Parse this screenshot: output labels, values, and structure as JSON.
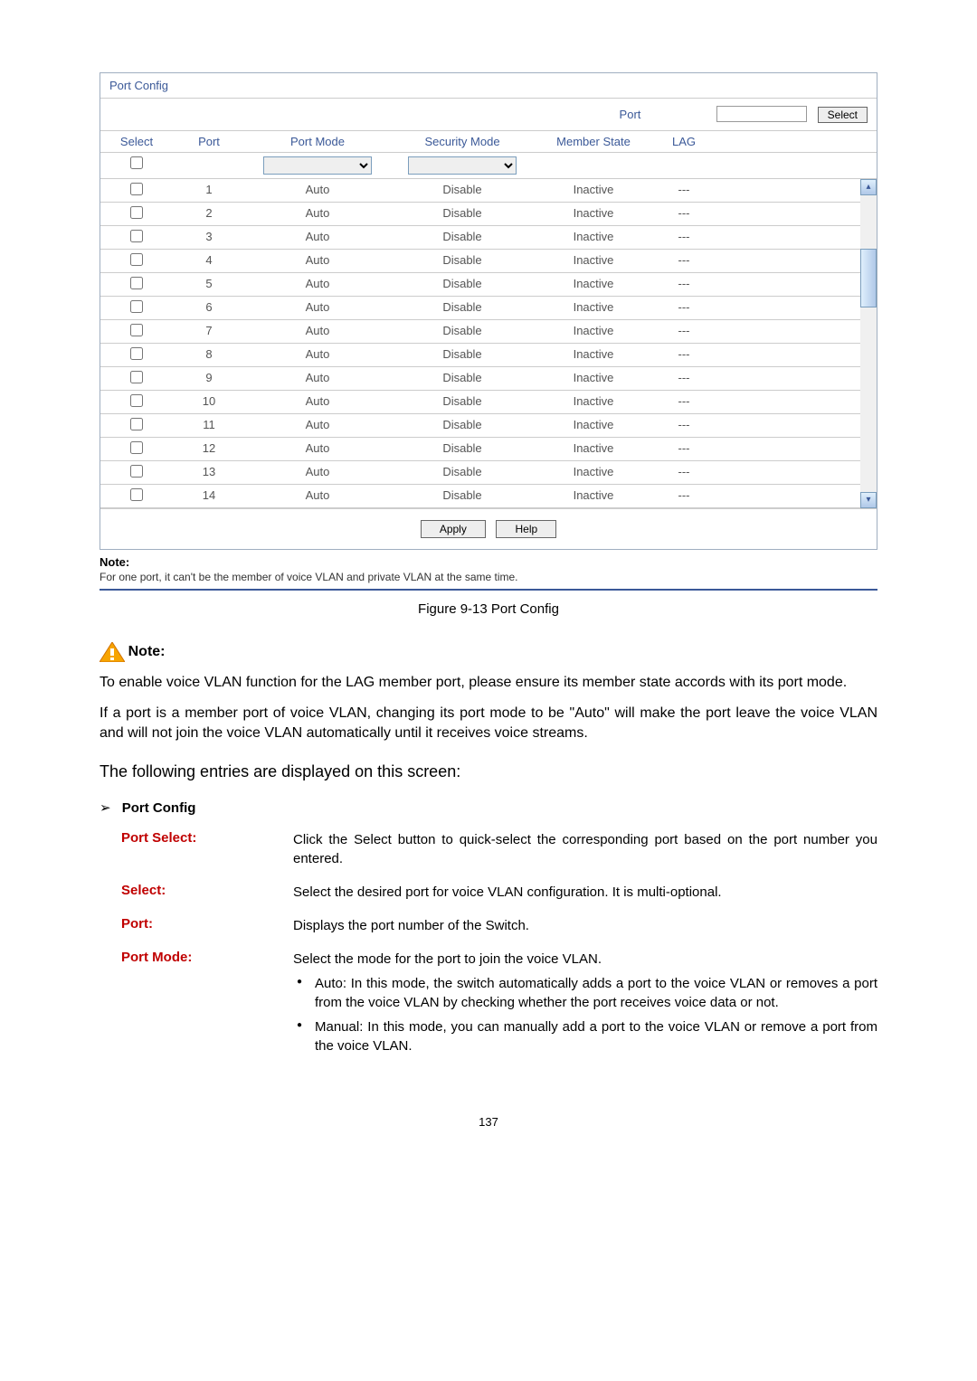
{
  "panel": {
    "title": "Port Config",
    "portLabel": "Port",
    "selectBtn": "Select",
    "headers": {
      "select": "Select",
      "port": "Port",
      "portMode": "Port Mode",
      "securityMode": "Security Mode",
      "memberState": "Member State",
      "lag": "LAG"
    },
    "rows": [
      {
        "port": "1",
        "portMode": "Auto",
        "secMode": "Disable",
        "memberState": "Inactive",
        "lag": "---"
      },
      {
        "port": "2",
        "portMode": "Auto",
        "secMode": "Disable",
        "memberState": "Inactive",
        "lag": "---"
      },
      {
        "port": "3",
        "portMode": "Auto",
        "secMode": "Disable",
        "memberState": "Inactive",
        "lag": "---"
      },
      {
        "port": "4",
        "portMode": "Auto",
        "secMode": "Disable",
        "memberState": "Inactive",
        "lag": "---"
      },
      {
        "port": "5",
        "portMode": "Auto",
        "secMode": "Disable",
        "memberState": "Inactive",
        "lag": "---"
      },
      {
        "port": "6",
        "portMode": "Auto",
        "secMode": "Disable",
        "memberState": "Inactive",
        "lag": "---"
      },
      {
        "port": "7",
        "portMode": "Auto",
        "secMode": "Disable",
        "memberState": "Inactive",
        "lag": "---"
      },
      {
        "port": "8",
        "portMode": "Auto",
        "secMode": "Disable",
        "memberState": "Inactive",
        "lag": "---"
      },
      {
        "port": "9",
        "portMode": "Auto",
        "secMode": "Disable",
        "memberState": "Inactive",
        "lag": "---"
      },
      {
        "port": "10",
        "portMode": "Auto",
        "secMode": "Disable",
        "memberState": "Inactive",
        "lag": "---"
      },
      {
        "port": "11",
        "portMode": "Auto",
        "secMode": "Disable",
        "memberState": "Inactive",
        "lag": "---"
      },
      {
        "port": "12",
        "portMode": "Auto",
        "secMode": "Disable",
        "memberState": "Inactive",
        "lag": "---"
      },
      {
        "port": "13",
        "portMode": "Auto",
        "secMode": "Disable",
        "memberState": "Inactive",
        "lag": "---"
      },
      {
        "port": "14",
        "portMode": "Auto",
        "secMode": "Disable",
        "memberState": "Inactive",
        "lag": "---"
      }
    ],
    "applyBtn": "Apply",
    "helpBtn": "Help"
  },
  "inlineNote": {
    "title": "Note:",
    "text": "For one port, it can't be the member of voice VLAN and private VLAN at the same time."
  },
  "figureCaption": "Figure 9-13 Port Config",
  "noteBlock": {
    "label": "Note:",
    "para1": "To enable voice VLAN function for the LAG member port, please ensure its member state accords with its port mode.",
    "para2": "If a port is a member port of voice VLAN, changing its port mode to be \"Auto\" will make the port leave the voice VLAN and will not join the voice VLAN automatically until it receives voice streams."
  },
  "entriesIntro": "The following entries are displayed on this screen:",
  "subHeading": "Port Config",
  "desc": {
    "portSelect": {
      "term": "Port Select:",
      "def": "Click the Select button to quick-select the corresponding port based on the port number you entered."
    },
    "select": {
      "term": "Select:",
      "def": "Select the desired port for voice VLAN configuration. It is multi-optional."
    },
    "port": {
      "term": "Port:",
      "def": "Displays the port number of the Switch."
    },
    "portMode": {
      "term": "Port Mode:",
      "def": "Select the mode for the port to join the voice VLAN.",
      "bullet1": "Auto: In this mode, the switch automatically adds a port to the voice VLAN or removes a port from the voice VLAN by checking whether the port receives voice data or not.",
      "bullet2": "Manual: In this mode, you can manually add a port to the voice VLAN or remove a port from the voice VLAN."
    }
  },
  "pageNum": "137"
}
